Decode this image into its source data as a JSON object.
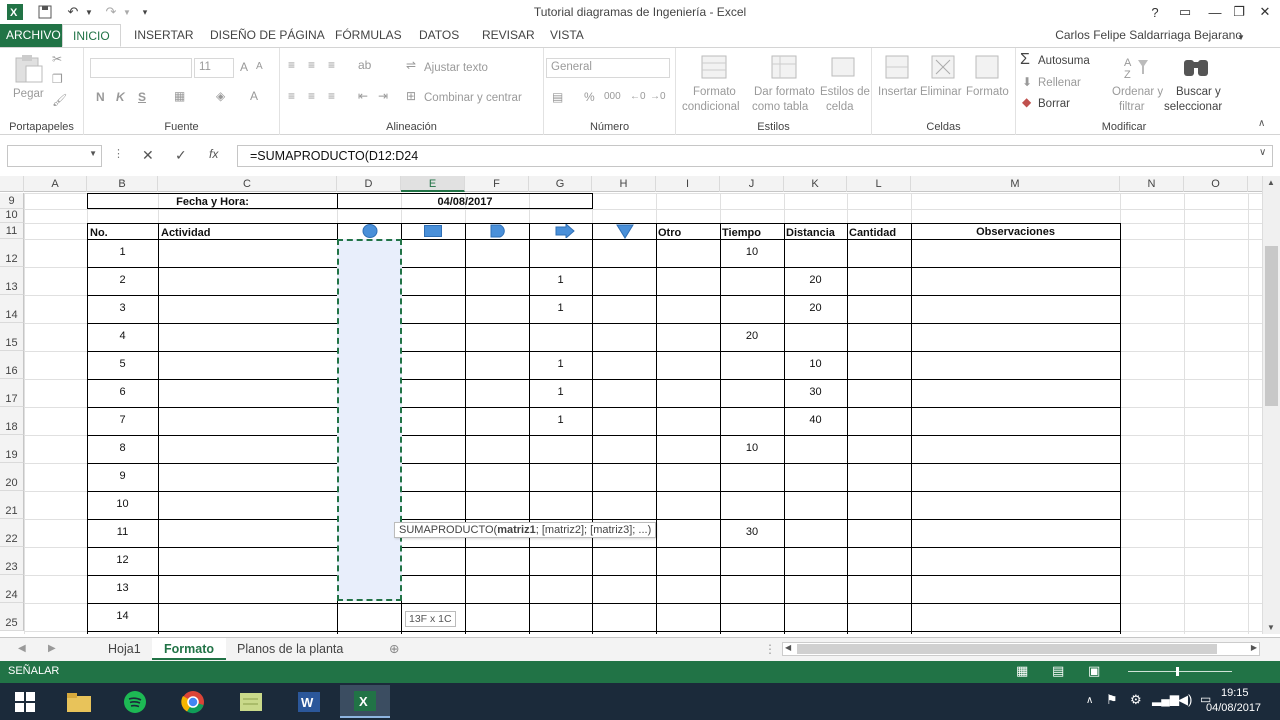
{
  "window": {
    "title": "Tutorial diagramas de Ingeniería - Excel",
    "user": "Carlos Felipe Saldarriaga Bejarano"
  },
  "ribbon_tabs": [
    "ARCHIVO",
    "INICIO",
    "INSERTAR",
    "DISEÑO DE PÁGINA",
    "FÓRMULAS",
    "DATOS",
    "REVISAR",
    "VISTA"
  ],
  "ribbon": {
    "portapapeles": {
      "label": "Portapapeles",
      "paste": "Pegar"
    },
    "fuente": {
      "label": "Fuente",
      "font_size": "11",
      "bold": "N",
      "italic": "K",
      "underline": "S"
    },
    "alineacion": {
      "label": "Alineación",
      "wrap": "Ajustar texto",
      "merge": "Combinar y centrar"
    },
    "numero": {
      "label": "Número",
      "format": "General",
      "percent": "%",
      "thousands": "000"
    },
    "estilos": {
      "label": "Estilos",
      "cond_1": "Formato",
      "cond_2": "condicional",
      "table_1": "Dar formato",
      "table_2": "como tabla",
      "cell_1": "Estilos de",
      "cell_2": "celda"
    },
    "celdas": {
      "label": "Celdas",
      "insert": "Insertar",
      "delete": "Eliminar",
      "format": "Formato"
    },
    "modificar": {
      "label": "Modificar",
      "autosum": "Autosuma",
      "fill": "Rellenar",
      "clear": "Borrar",
      "sort_1": "Ordenar y",
      "sort_2": "filtrar",
      "find_1": "Buscar y",
      "find_2": "seleccionar"
    }
  },
  "formula_bar": {
    "name_box": "",
    "fx": "fx",
    "formula": "=SUMAPRODUCTO(D12:D24"
  },
  "columns": [
    "A",
    "B",
    "C",
    "D",
    "E",
    "F",
    "G",
    "H",
    "I",
    "J",
    "K",
    "L",
    "M",
    "N",
    "O"
  ],
  "rows": [
    "9",
    "10",
    "11",
    "12",
    "13",
    "14",
    "15",
    "16",
    "17",
    "18",
    "19",
    "20",
    "21",
    "22",
    "23",
    "24",
    "25"
  ],
  "sheet": {
    "fecha_label": "Fecha y Hora:",
    "fecha_value": "04/08/2017",
    "headers": {
      "no": "No.",
      "actividad": "Actividad",
      "otro": "Otro",
      "tiempo": "Tiempo",
      "distancia": "Distancia",
      "cantidad": "Cantidad",
      "observaciones": "Observaciones"
    },
    "numbers": [
      "1",
      "2",
      "3",
      "4",
      "5",
      "6",
      "7",
      "8",
      "9",
      "10",
      "11",
      "12",
      "13",
      "14"
    ],
    "g_values": [
      "",
      "1",
      "1",
      "",
      "1",
      "1",
      "1",
      "",
      "",
      "",
      "",
      "",
      "",
      ""
    ],
    "j_values": [
      "10",
      "",
      "",
      "20",
      "",
      "",
      "",
      "10",
      "",
      "",
      "30",
      "",
      "",
      ""
    ],
    "k_values": [
      "",
      "20",
      "20",
      "",
      "10",
      "30",
      "40",
      "",
      "",
      "",
      "",
      "",
      "",
      ""
    ]
  },
  "tooltip": {
    "fn": "SUMAPRODUCTO(",
    "arg1": "matriz1",
    "rest": "; [matriz2]; [matriz3]; ...)"
  },
  "size_tip": "13F x 1C",
  "sheet_tabs": [
    "Hoja1",
    "Formato",
    "Planos de la planta"
  ],
  "status": "SEÑALAR",
  "taskbar": {
    "time": "19:15",
    "date": "04/08/2017"
  },
  "colors": {
    "excel_green": "#217346",
    "selection": "#e8eefb",
    "symbol_blue": "#4a90d9"
  }
}
